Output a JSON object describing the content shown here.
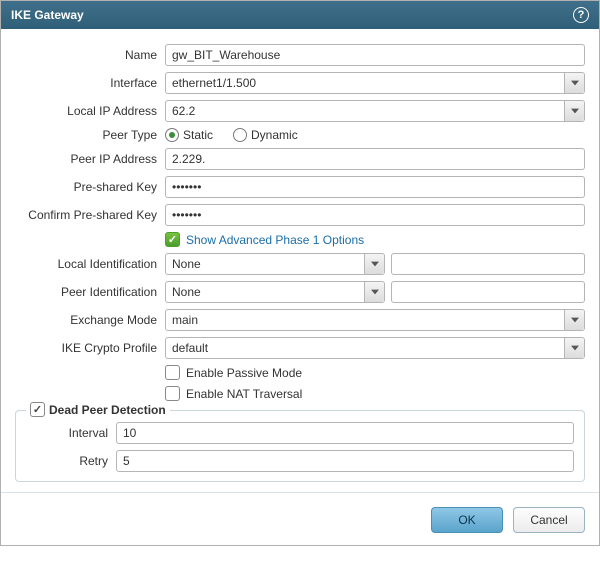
{
  "title": "IKE Gateway",
  "labels": {
    "name": "Name",
    "interface": "Interface",
    "localip": "Local IP Address",
    "peertype": "Peer Type",
    "peerip": "Peer IP Address",
    "psk": "Pre-shared Key",
    "cpsk": "Confirm Pre-shared Key",
    "showadv": "Show Advanced Phase 1 Options",
    "localid": "Local Identification",
    "peerid": "Peer Identification",
    "exmode": "Exchange Mode",
    "ikeprof": "IKE Crypto Profile",
    "passive": "Enable Passive Mode",
    "nat": "Enable NAT Traversal",
    "dpd": "Dead Peer Detection",
    "interval": "Interval",
    "retry": "Retry",
    "static": "Static",
    "dynamic": "Dynamic"
  },
  "values": {
    "name": "gw_BIT_Warehouse",
    "interface": "ethernet1/1.500",
    "localip": "62.2",
    "peerip": "2.229.",
    "psk": "•••••••",
    "cpsk": "•••••••",
    "localid": "None",
    "peerid": "None",
    "exmode": "main",
    "ikeprof": "default",
    "interval": "10",
    "retry": "5"
  },
  "buttons": {
    "ok": "OK",
    "cancel": "Cancel"
  }
}
